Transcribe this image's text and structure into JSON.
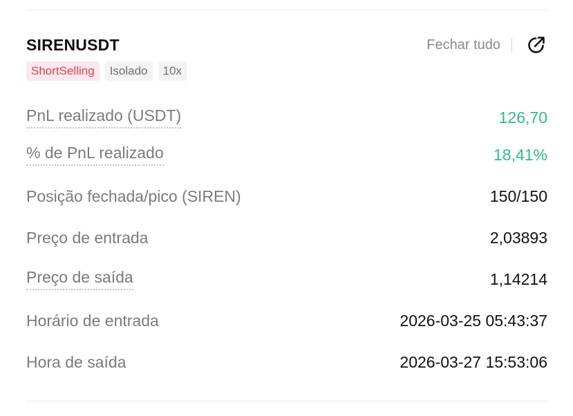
{
  "position": {
    "symbol": "SIRENUSDT",
    "close_all_label": "Fechar tudo",
    "share_icon": "share-arrow-icon",
    "tags": [
      "ShortSelling",
      "Isolado",
      "10x"
    ],
    "colors": {
      "positive": "#2ebd85",
      "short_tag_text": "#e0415a",
      "short_tag_bg": "#fbe9ec"
    },
    "rows": [
      {
        "label": "PnL realizado (USDT)",
        "value": "126,70"
      },
      {
        "label": "% de PnL realizado",
        "value": "18,41%"
      },
      {
        "label": "Posição fechada/pico (SIREN)",
        "value": "150/150"
      },
      {
        "label": "Preço de entrada",
        "value": "2,03893"
      },
      {
        "label": "Preço de saída",
        "value": "1,14214"
      },
      {
        "label": "Horário de entrada",
        "value": "2026-03-25 05:43:37"
      },
      {
        "label": "Hora de saída",
        "value": "2026-03-27 15:53:06"
      }
    ]
  }
}
